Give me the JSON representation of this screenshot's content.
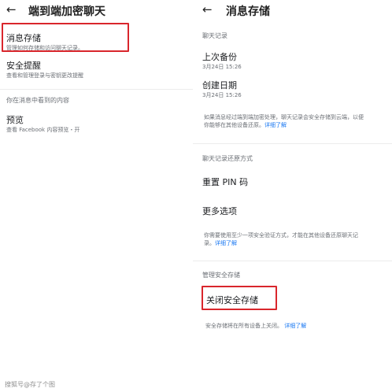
{
  "left": {
    "title": "端到端加密聊天",
    "items": [
      {
        "title": "消息存储",
        "subtitle": "管理如何存储和访问聊天记录。"
      },
      {
        "title": "安全提醒",
        "subtitle": "查看和管理登录与密钥更改提醒"
      }
    ],
    "section": "你在消息中看到的内容",
    "preview": {
      "title": "预览",
      "subtitle": "查看 Facebook 内容预览・开"
    }
  },
  "right": {
    "title": "消息存储",
    "section_history": "聊天记录",
    "last_backup": {
      "title": "上次备份",
      "date": "3月24日 15:26"
    },
    "created": {
      "title": "创建日期",
      "date": "3月24日 15:26"
    },
    "info1": {
      "lines": [
        "如果消息经过端到端加密处理，聊天记录会安全存储到云端，以便",
        "你能够在其他设备还原。"
      ],
      "link": "详细了解"
    },
    "section_restore": "聊天记录还原方式",
    "reset_pin": "重置 PIN 码",
    "more_options": "更多选项",
    "info2": {
      "lines": [
        "你需要使用至少一项安全验证方式，才能在其他设备还原聊天记",
        "录。"
      ],
      "link": "详细了解"
    },
    "section_manage": "管理安全存储",
    "turn_off": "关闭安全存储",
    "info3": {
      "text": "安全存储将在所有设备上关闭。",
      "link": "详细了解"
    }
  },
  "watermark": "搜狐号@存了个图",
  "colors": {
    "highlight": "#d9262c",
    "link": "#1877f2"
  }
}
